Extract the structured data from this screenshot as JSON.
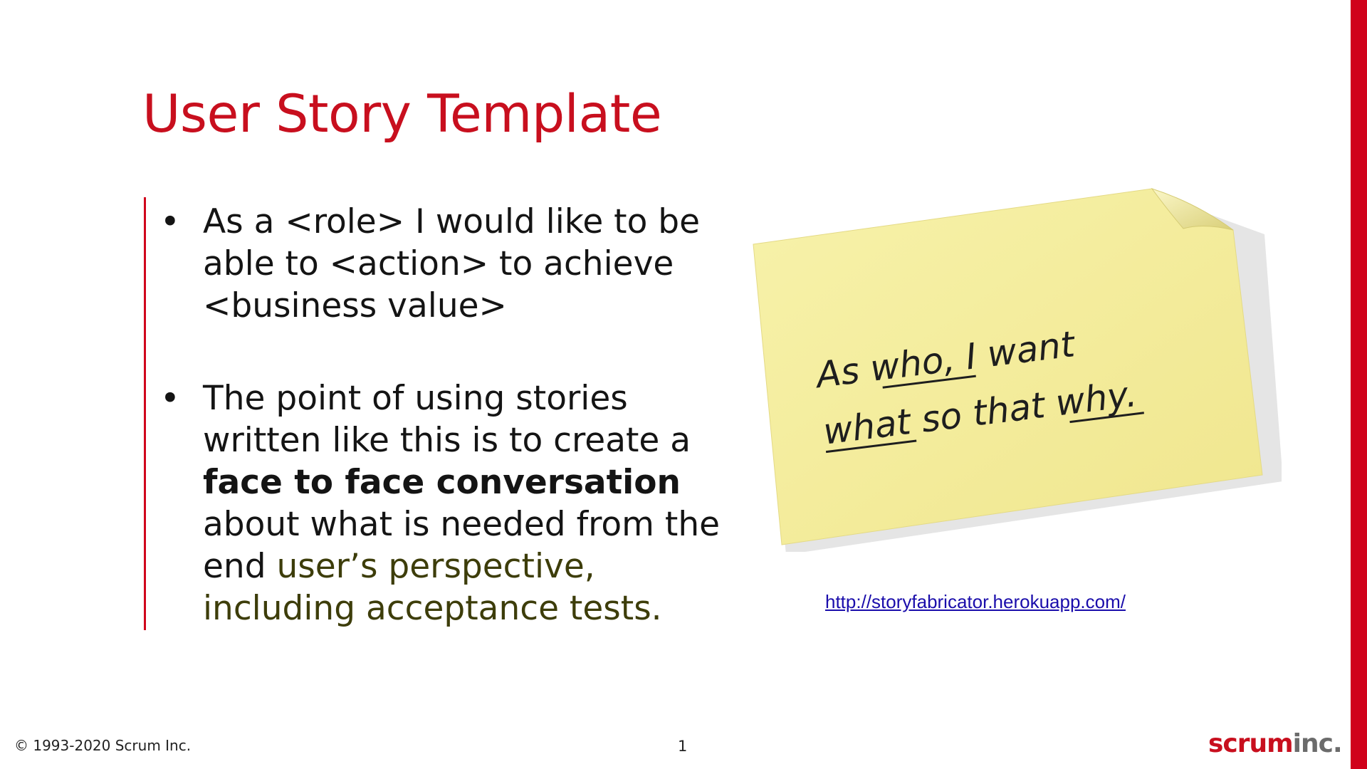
{
  "slide": {
    "title": "User Story Template",
    "bullets": [
      {
        "parts": [
          {
            "text": "As a <role> I would like to be able to <action> to achieve <business value>",
            "style": "normal"
          }
        ]
      },
      {
        "parts": [
          {
            "text": "The point of using stories written like this is to create a ",
            "style": "normal"
          },
          {
            "text": "face to face conversation",
            "style": "bold"
          },
          {
            "text": " about what is needed from the end",
            "style": "normal"
          },
          {
            "text": " user’s perspective, including acceptance tests.",
            "style": "olive"
          }
        ]
      }
    ],
    "bullet_glyph": "•",
    "sticky_note": {
      "line1": "As who, I want",
      "line2": "what so that why.",
      "color": "#f6f0a4"
    },
    "link": "http://storyfabricator.herokuapp.com/",
    "footer": {
      "copyright": "© 1993-2020 Scrum Inc.",
      "page_number": "1",
      "logo_part1": "scrum",
      "logo_part2": "inc."
    },
    "colors": {
      "accent": "#d0021b",
      "title": "#c80f1e",
      "olive_text": "#3d3d0a",
      "link": "#1a0dab"
    }
  }
}
